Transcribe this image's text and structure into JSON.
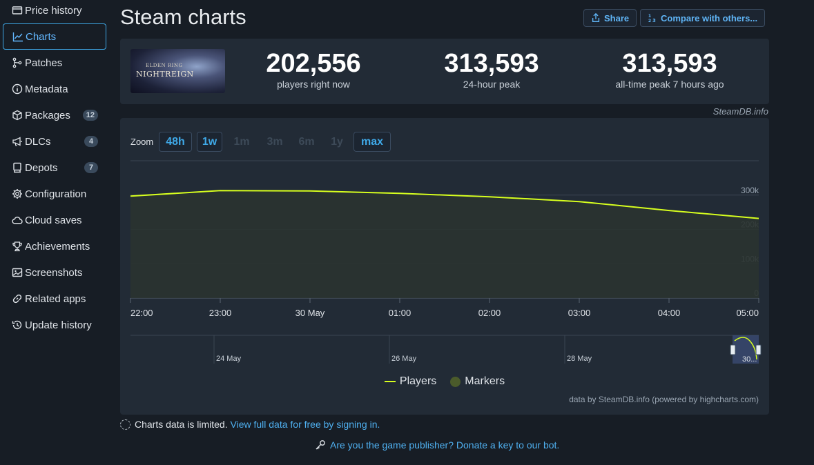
{
  "sidebar": {
    "items": [
      {
        "label": "Price history",
        "icon": "price-history-icon"
      },
      {
        "label": "Charts",
        "icon": "chart-line-icon",
        "active": true
      },
      {
        "label": "Patches",
        "icon": "branch-icon"
      },
      {
        "label": "Metadata",
        "icon": "info-icon"
      },
      {
        "label": "Packages",
        "icon": "box-icon",
        "badge": "12"
      },
      {
        "label": "DLCs",
        "icon": "megaphone-icon",
        "badge": "4"
      },
      {
        "label": "Depots",
        "icon": "depot-icon",
        "badge": "7"
      },
      {
        "label": "Configuration",
        "icon": "gear-icon"
      },
      {
        "label": "Cloud saves",
        "icon": "cloud-icon"
      },
      {
        "label": "Achievements",
        "icon": "trophy-icon"
      },
      {
        "label": "Screenshots",
        "icon": "image-icon"
      },
      {
        "label": "Related apps",
        "icon": "link-icon"
      },
      {
        "label": "Update history",
        "icon": "history-icon"
      }
    ]
  },
  "header": {
    "title": "Steam charts",
    "share_label": "Share",
    "compare_label": "Compare with others..."
  },
  "game": {
    "logo_line1": "ELDEN RING",
    "logo_line2": "NIGHTREIGN"
  },
  "stats": {
    "now_value": "202,556",
    "now_label": "players right now",
    "peak24_value": "313,593",
    "peak24_label": "24-hour peak",
    "alltime_value": "313,593",
    "alltime_label": "all-time peak 7 hours ago"
  },
  "watermark": "SteamDB.info",
  "zoom": {
    "label": "Zoom",
    "buttons": [
      {
        "label": "48h",
        "enabled": true
      },
      {
        "label": "1w",
        "enabled": true
      },
      {
        "label": "1m",
        "enabled": false
      },
      {
        "label": "3m",
        "enabled": false
      },
      {
        "label": "6m",
        "enabled": false
      },
      {
        "label": "1y",
        "enabled": false
      },
      {
        "label": "max",
        "enabled": true
      }
    ]
  },
  "chart_data": {
    "type": "area",
    "x": [
      "22:00",
      "23:00",
      "30 May",
      "01:00",
      "02:00",
      "03:00",
      "04:00",
      "05:00"
    ],
    "series": [
      {
        "name": "Players",
        "values": [
          297000,
          313000,
          312000,
          305000,
          295000,
          281000,
          255000,
          232000
        ],
        "color": "#d7ff1e"
      }
    ],
    "ylim": [
      0,
      400000
    ],
    "yticks": [
      "0",
      "100k",
      "200k",
      "300k"
    ],
    "navigator_labels": [
      "24 May",
      "26 May",
      "28 May",
      "30..."
    ],
    "legend": [
      "Players",
      "Markers"
    ],
    "grid": true
  },
  "legend": {
    "players": "Players",
    "markers": "Markers"
  },
  "credits": "data by SteamDB.info (powered by highcharts.com)",
  "notes": {
    "limited_text": "Charts data is limited.",
    "limited_link": "View full data for free by signing in.",
    "publisher_link": "Are you the game publisher? Donate a key to our bot."
  }
}
